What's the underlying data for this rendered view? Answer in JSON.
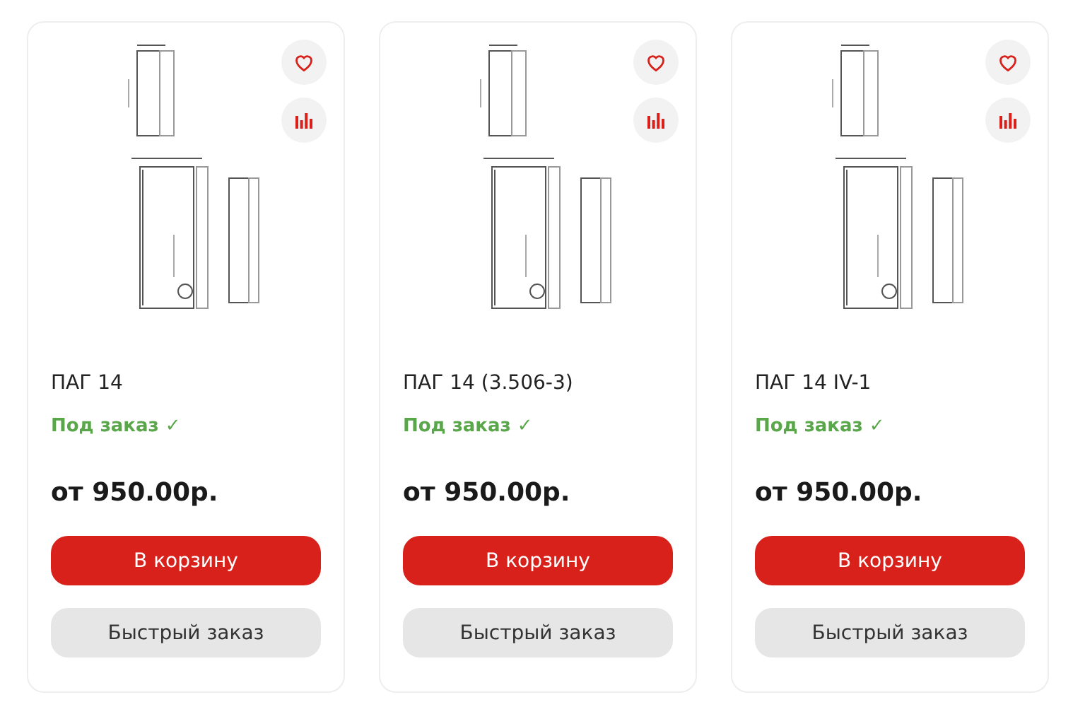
{
  "products": [
    {
      "title": "ПАГ 14",
      "availability": "Под заказ ✓",
      "price": "от 950.00р.",
      "cart_button": "В корзину",
      "quick_order_button": "Быстрый заказ"
    },
    {
      "title": "ПАГ 14 (3.506-3)",
      "availability": "Под заказ ✓",
      "price": "от 950.00р.",
      "cart_button": "В корзину",
      "quick_order_button": "Быстрый заказ"
    },
    {
      "title": "ПАГ 14 IV-1",
      "availability": "Под заказ ✓",
      "price": "от 950.00р.",
      "cart_button": "В корзину",
      "quick_order_button": "Быстрый заказ"
    }
  ]
}
